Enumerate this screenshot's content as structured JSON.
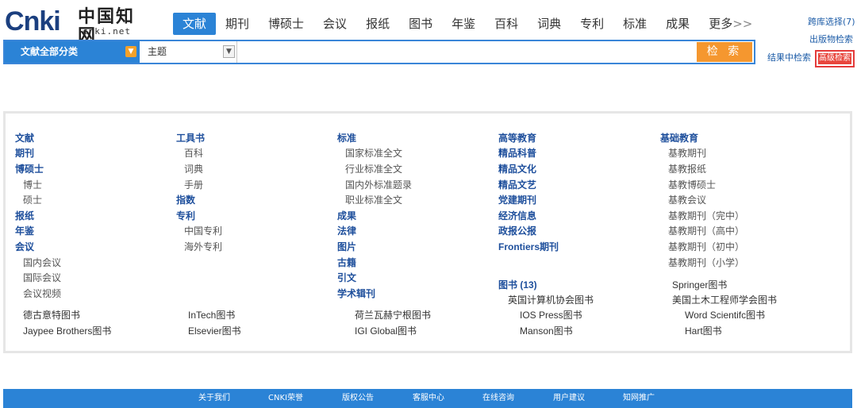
{
  "logo": {
    "word_c": "C",
    "word_rest": "nki",
    "chinese": "中国知网",
    "url": "cnki.net"
  },
  "tabs": [
    "文献",
    "期刊",
    "博硕士",
    "会议",
    "报纸",
    "图书",
    "年鉴",
    "百科",
    "词典",
    "专利",
    "标准",
    "成果",
    "更多"
  ],
  "more_arrow": ">>",
  "right_links": {
    "cross_db": "跨库选择(7)",
    "publication_search": "出版物检索",
    "in_result_search": "结果中检索"
  },
  "search": {
    "category_label": "文献全部分类",
    "field": "主题",
    "button": "检 索",
    "advanced": "高级检索",
    "query": ""
  },
  "columns": {
    "c1": [
      "文献",
      "期刊",
      "博硕士",
      "博士",
      "硕士",
      "报纸",
      "年鉴",
      "会议",
      "国内会议",
      "国际会议",
      "会议视频"
    ],
    "c2": [
      "工具书",
      "百科",
      "词典",
      "手册",
      "指数",
      "专利",
      "中国专利",
      "海外专利"
    ],
    "c3": [
      "标准",
      "国家标准全文",
      "行业标准全文",
      "国内外标准题录",
      "职业标准全文",
      "成果",
      "法律",
      "图片",
      "古籍",
      "引文",
      "学术辑刊"
    ],
    "c4": [
      "高等教育",
      "精品科普",
      "精品文化",
      "精品文艺",
      "党建期刊",
      "经济信息",
      "政报公报",
      "Frontiers期刊"
    ],
    "c5": [
      "基础教育",
      "基教期刊",
      "基教报纸",
      "基教博硕士",
      "基教会议",
      "基教期刊（完中）",
      "基教期刊（高中）",
      "基教期刊（初中）",
      "基教期刊（小学）"
    ]
  },
  "books": {
    "header": "图书 (13)",
    "items": [
      "德古意特图书",
      "InTech图书",
      "荷兰瓦赫宁根图书",
      "英国计算机协会图书",
      "IOS Press图书",
      "Springer图书",
      "美国土木工程师学会图书",
      "Jaypee Brothers图书",
      "Elsevier图书",
      "IGI Global图书",
      "Manson图书",
      "Word Scientifc图书",
      "Hart图书"
    ]
  },
  "footer": [
    "关于我们",
    "CNKI荣誉",
    "版权公告",
    "客服中心",
    "在线咨询",
    "用户建议",
    "知网推广"
  ]
}
